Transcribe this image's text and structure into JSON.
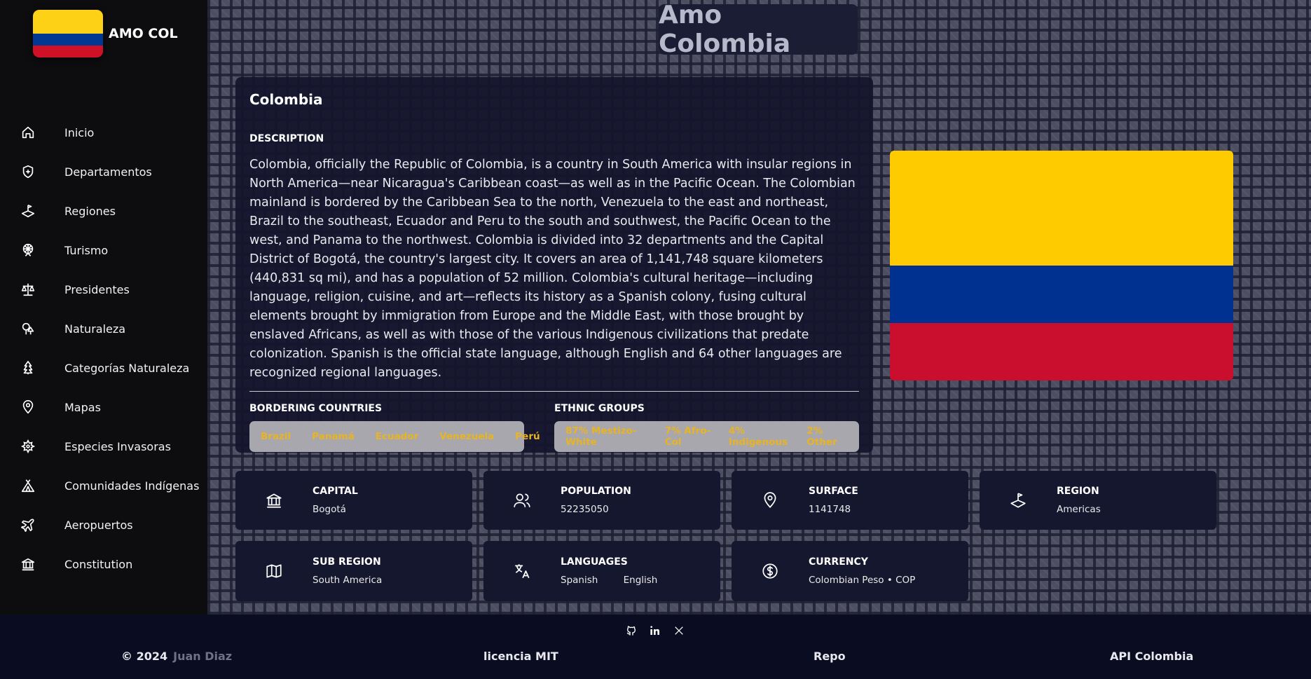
{
  "brand": {
    "name": "AMO COL"
  },
  "page": {
    "title": "Amo Colombia"
  },
  "sidebar": {
    "items": [
      {
        "label": "Inicio",
        "icon": "home-icon"
      },
      {
        "label": "Departamentos",
        "icon": "shield-icon"
      },
      {
        "label": "Regiones",
        "icon": "region-flag-icon"
      },
      {
        "label": "Turismo",
        "icon": "ferris-wheel-icon"
      },
      {
        "label": "Presidentes",
        "icon": "scale-icon"
      },
      {
        "label": "Naturaleza",
        "icon": "trees-icon"
      },
      {
        "label": "Categorías Naturaleza",
        "icon": "pine-tree-icon"
      },
      {
        "label": "Mapas",
        "icon": "map-pin-icon"
      },
      {
        "label": "Especies Invasoras",
        "icon": "virus-icon"
      },
      {
        "label": "Comunidades Indígenas",
        "icon": "tent-icon"
      },
      {
        "label": "Aeropuertos",
        "icon": "plane-icon"
      },
      {
        "label": "Constitution",
        "icon": "building-columns-icon"
      }
    ]
  },
  "country": {
    "name": "Colombia",
    "description_label": "DESCRIPTION",
    "description": "Colombia, officially the Republic of Colombia, is a country in South America with insular regions in North America—near Nicaragua's Caribbean coast—as well as in the Pacific Ocean. The Colombian mainland is bordered by the Caribbean Sea to the north, Venezuela to the east and northeast, Brazil to the southeast, Ecuador and Peru to the south and southwest, the Pacific Ocean to the west, and Panama to the northwest. Colombia is divided into 32 departments and the Capital District of Bogotá, the country's largest city. It covers an area of 1,141,748 square kilometers (440,831 sq mi), and has a population of 52 million. Colombia's cultural heritage—including language, religion, cuisine, and art—reflects its history as a Spanish colony, fusing cultural elements brought by immigration from Europe and the Middle East, with those brought by enslaved Africans, as well as with those of the various Indigenous civilizations that predate colonization. Spanish is the official state language, although English and 64 other languages are recognized regional languages.",
    "bordering_label": "BORDERING COUNTRIES",
    "bordering": [
      "Brazil",
      "Panamá",
      "Ecuador",
      "Venezuela",
      "Perú"
    ],
    "ethnic_label": "ETHNIC GROUPS",
    "ethnic": [
      "87% Mestizo-White",
      "7% Afro-Col",
      "4% Indigenous",
      "2% Other"
    ]
  },
  "flag_colors": {
    "yellow": "#fecb00",
    "blue": "#003191",
    "red": "#ca0f2e"
  },
  "stats": {
    "capital": {
      "label": "CAPITAL",
      "value": "Bogotá"
    },
    "population": {
      "label": "POPULATION",
      "value": "52235050"
    },
    "surface": {
      "label": "SURFACE",
      "value": "1141748"
    },
    "region": {
      "label": "REGION",
      "value": "Americas"
    },
    "subregion": {
      "label": "SUB REGION",
      "value": "South America"
    },
    "languages": {
      "label": "LANGUAGES",
      "values": [
        "Spanish",
        "English"
      ]
    },
    "currency": {
      "label": "CURRENCY",
      "value": "Colombian Peso • COP"
    }
  },
  "footer": {
    "copyright": "© 2024",
    "author": "Juan Diaz",
    "license": "licencia MIT",
    "repo": "Repo",
    "api": "API Colombia",
    "social": [
      "github-icon",
      "linkedin-icon",
      "x-icon"
    ]
  }
}
